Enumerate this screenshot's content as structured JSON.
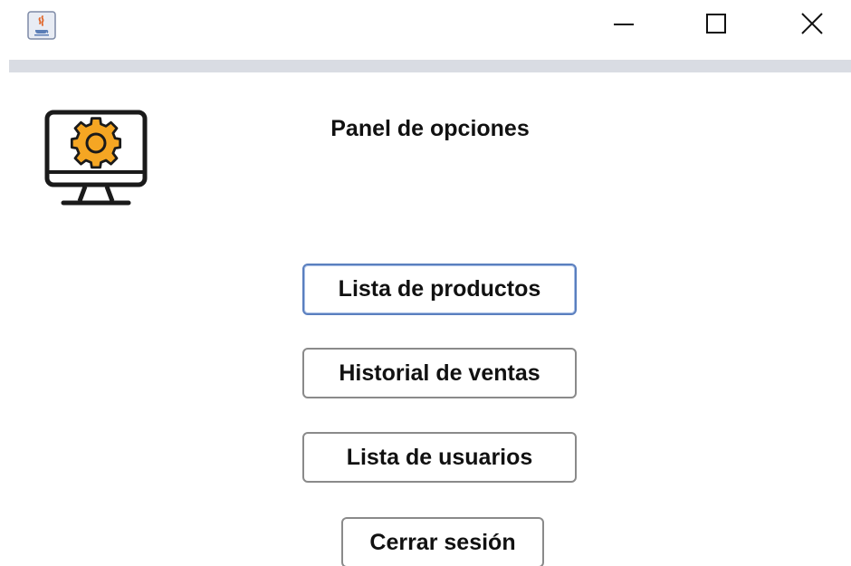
{
  "window": {
    "app_icon": "java-coffee-icon",
    "controls": {
      "minimize_icon": "minimize-icon",
      "maximize_icon": "maximize-icon",
      "close_icon": "close-icon"
    }
  },
  "header": {
    "icon": "monitor-gear-icon",
    "title": "Panel de opciones"
  },
  "menu": {
    "buttons": [
      {
        "label": "Lista de productos"
      },
      {
        "label": "Historial de ventas"
      },
      {
        "label": "Lista de usuarios"
      },
      {
        "label": "Cerrar sesión"
      }
    ]
  },
  "colors": {
    "gear_fill": "#f5a623",
    "outline": "#1a1a1a",
    "divider": "#d9dce3",
    "focus_border": "#5a7fbf"
  }
}
